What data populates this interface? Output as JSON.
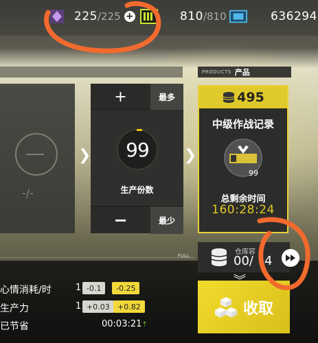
{
  "resources": {
    "stamina": {
      "icon": "stamina-icon",
      "current": "225",
      "max": "/225",
      "plus": "+"
    },
    "drones": {
      "icon": "drone-battery-icon",
      "current": "810",
      "max": "/810"
    },
    "credits": {
      "icon": "lmd-ticket-icon",
      "value": "636294"
    }
  },
  "products_header": {
    "en": "PRODUCTS",
    "cn": "产品"
  },
  "empty_slot": {
    "ratio": "-/-"
  },
  "quantity": {
    "plus": "+",
    "max_label": "最多",
    "minus": "−",
    "min_label": "最少",
    "value": "99",
    "label": "生产份数"
  },
  "product": {
    "cost": "495",
    "name": "中级作战记录",
    "item_count": "99",
    "time_label": "总剩余时间",
    "time_value": "160:28:24"
  },
  "storage": {
    "full_label": "FULL",
    "label": "仓库容",
    "value": "00/",
    "value_rest": "4"
  },
  "stats": [
    {
      "label": "心情消耗/时",
      "num": "1",
      "gray": "-0.1",
      "yellow": "-0.25"
    },
    {
      "label": "生产力",
      "num": "1",
      "gray": "+0.03",
      "yellow": "+0.82"
    },
    {
      "label": "已节省",
      "time": "00:03:21",
      "time_arrow": "⇡"
    }
  ],
  "collect": {
    "label": "收取"
  },
  "colors": {
    "accent": "#e0c92a",
    "annotation": "#f26a2e"
  }
}
